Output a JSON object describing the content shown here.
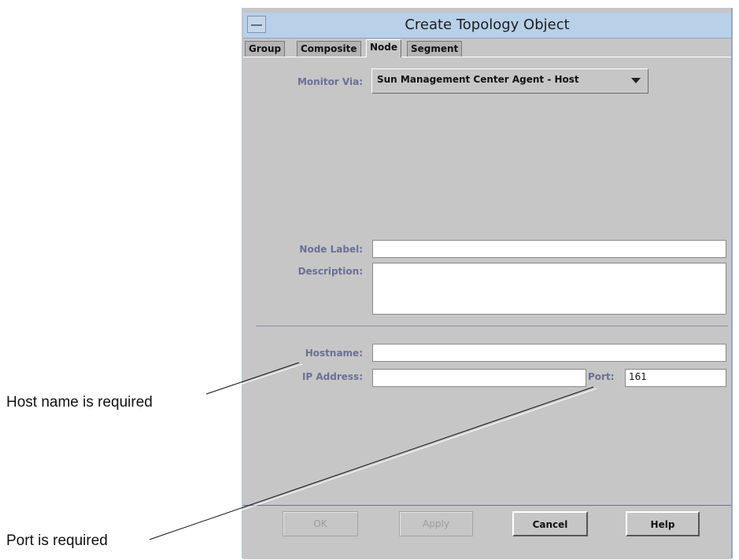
{
  "annotations": {
    "hostname_note": "Host name is required",
    "port_note": "Port is required"
  },
  "window": {
    "title": "Create Topology Object"
  },
  "tabs": [
    {
      "label": "Group",
      "active": false
    },
    {
      "label": "Composite",
      "active": false
    },
    {
      "label": "Node",
      "active": true
    },
    {
      "label": "Segment",
      "active": false
    }
  ],
  "form": {
    "monitor_via_label": "Monitor Via:",
    "monitor_via_value": "Sun Management Center Agent - Host",
    "node_label_label": "Node Label:",
    "node_label_value": "",
    "description_label": "Description:",
    "description_value": "",
    "hostname_label": "Hostname:",
    "hostname_value": "",
    "ip_address_label": "IP Address:",
    "ip_address_value": "",
    "port_label": "Port:",
    "port_value": "161"
  },
  "buttons": {
    "ok": "OK",
    "apply": "Apply",
    "cancel": "Cancel",
    "help": "Help"
  },
  "colors": {
    "titlebar": "#b8d0e8",
    "panel": "#c6c6c6",
    "label_text": "#6a6f98"
  }
}
